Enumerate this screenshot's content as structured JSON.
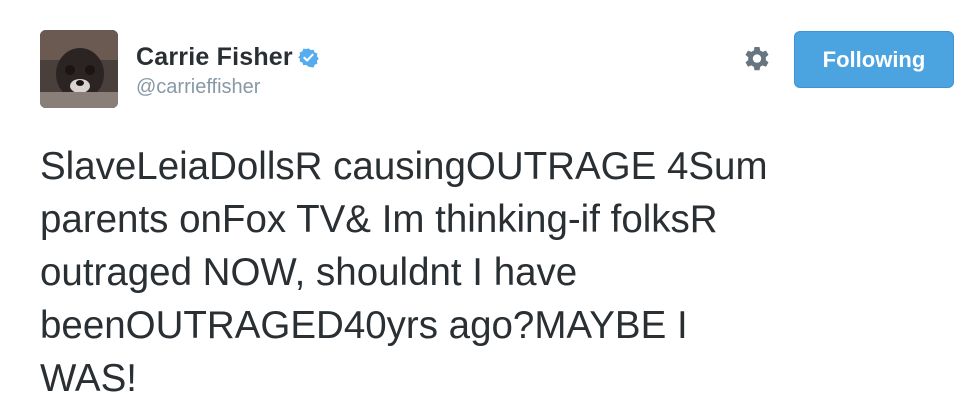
{
  "author": {
    "display_name": "Carrie Fisher",
    "handle": "@carrieffisher",
    "verified": true,
    "avatar_icon": "user-avatar-photo"
  },
  "actions": {
    "settings_icon": "gear-icon",
    "follow_label": "Following"
  },
  "tweet": {
    "text": "SlaveLeiaDollsR causingOUTRAGE 4Sum\nparents onFox TV& Im thinking-if folksR\noutraged NOW, shouldnt I have\nbeenOUTRAGED40yrs ago?MAYBE I\nWAS!"
  },
  "colors": {
    "accent": "#4ba3e0",
    "verified": "#55acee",
    "text": "#292f33",
    "muted": "#8899a6"
  }
}
